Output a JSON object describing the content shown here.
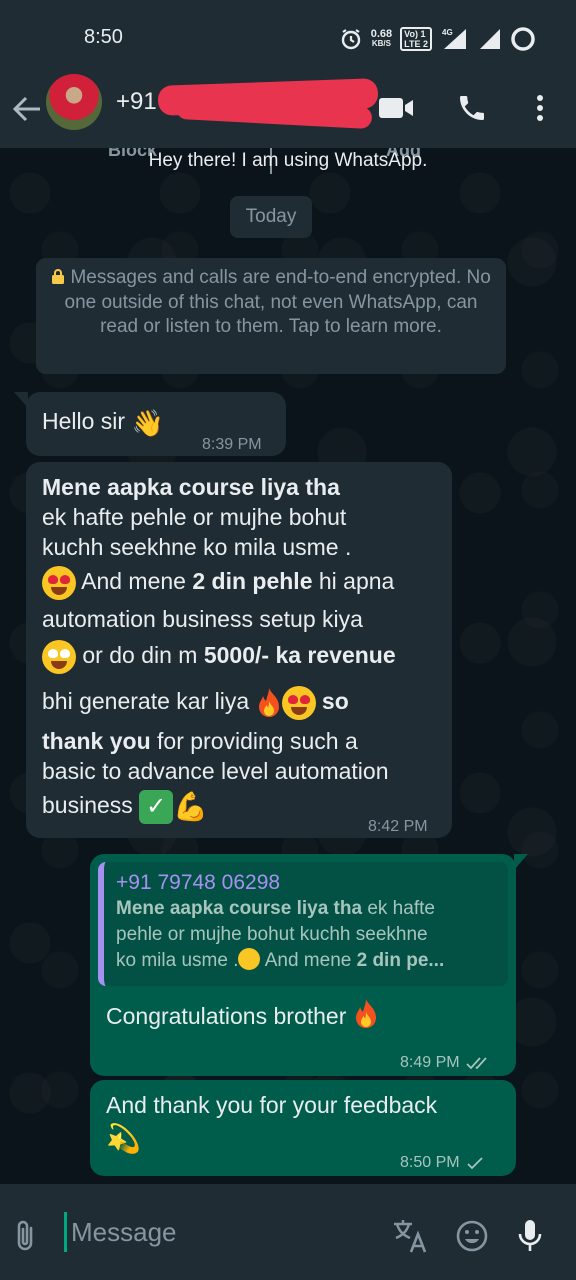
{
  "status_bar": {
    "time": "8:50",
    "net_speed_value": "0.68",
    "net_speed_unit": "KB/S",
    "volte_label": "Vo) 1\nLTE 2",
    "network_label": "4G"
  },
  "header": {
    "contact_name": "+91",
    "icons": [
      "back-arrow-icon",
      "video-call-icon",
      "voice-call-icon",
      "more-options-icon"
    ]
  },
  "chat": {
    "cutoff_left": "Block",
    "cutoff_right": "Add",
    "about": "Hey there! I am using WhatsApp.",
    "date_chip": "Today",
    "encryption_notice": "Messages and calls are end-to-end encrypted. No one outside of this chat, not even WhatsApp, can read or listen to them. Tap to learn more.",
    "messages": [
      {
        "direction": "incoming",
        "text": "Hello sir",
        "time": "8:39 PM"
      },
      {
        "direction": "incoming",
        "bold_1": "Mene aapka course liya tha",
        "line_2": "ek hafte pehle or mujhe bohut",
        "line_3": "kuchh seekhne ko mila usme .",
        "text_4a": " And mene ",
        "bold_4": "2 din pehle",
        "text_4b": " hi apna",
        "line_5": "automation business setup kiya",
        "text_6a": " or do din m ",
        "bold_6": "5000/- ka revenue",
        "text_7a": "bhi generate kar liya ",
        "bold_7": " so",
        "bold_8": "thank you",
        "text_8b": " for providing such a",
        "line_9": "basic to advance level automation",
        "text_10": "business ",
        "time": "8:42 PM"
      },
      {
        "direction": "outgoing",
        "quote_author": "+91 79748 06298",
        "quote_bold_1": "Mene aapka course liya tha",
        "quote_text_1": " ek hafte",
        "quote_line_2": "pehle or mujhe bohut kuchh seekhne",
        "quote_text_3a": "ko mila usme .",
        "quote_text_3b": " And mene ",
        "quote_bold_3": "2 din pe...",
        "text": "Congratulations brother",
        "time": "8:49 PM",
        "status": "read"
      },
      {
        "direction": "outgoing",
        "text": "And thank you for your feedback",
        "time": "8:50 PM",
        "status": "sent"
      }
    ]
  },
  "input_bar": {
    "placeholder": "Message",
    "icons": [
      "attach-icon",
      "translate-icon",
      "emoji-icon",
      "mic-icon"
    ]
  },
  "colors": {
    "bar_bg": "#1f2c34",
    "chat_bg": "#0b141a",
    "incoming_bubble": "#1f2c34",
    "outgoing_bubble": "#005c4b",
    "quote_accent": "#a791f0",
    "redaction": "#e8344e"
  }
}
